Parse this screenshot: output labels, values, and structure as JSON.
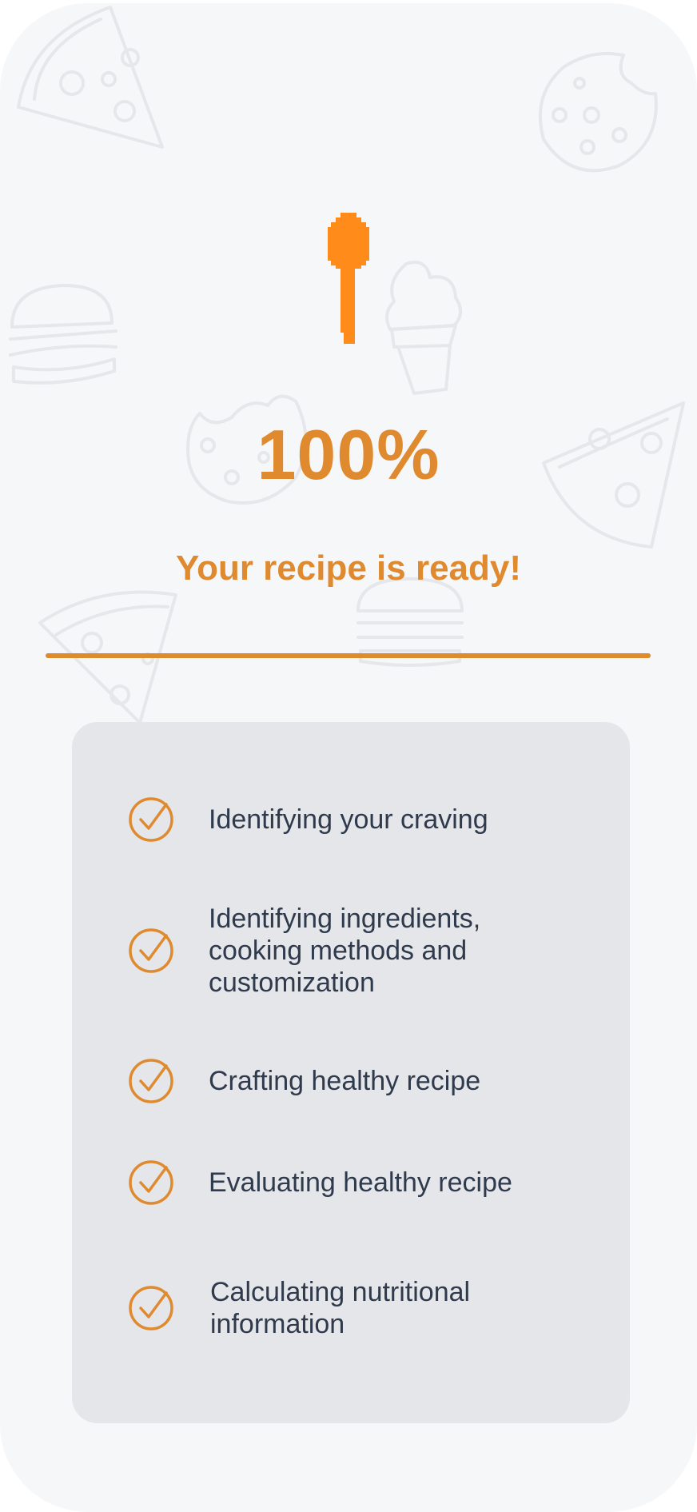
{
  "progress": {
    "percent_text": "100%",
    "value": 1.0
  },
  "status": {
    "title": "Your recipe is ready!"
  },
  "colors": {
    "accent": "#e08a2f",
    "spoon": "#ff8c1a",
    "background": "#f6f7f9",
    "card": "#e5e6e9",
    "text": "#2f3a4d"
  },
  "icons": {
    "loader": "spoon-icon",
    "step_status": "check-circle-icon",
    "background_pattern": [
      "pizza-icon",
      "cookie-icon",
      "burger-icon",
      "ice-cream-icon"
    ]
  },
  "steps": [
    {
      "label": "Identifying your craving",
      "done": true
    },
    {
      "label": "Identifying ingredients, cooking methods and customization",
      "done": true
    },
    {
      "label": "Crafting healthy recipe",
      "done": true
    },
    {
      "label": "Evaluating healthy recipe",
      "done": true
    },
    {
      "label": "Calculating nutritional information",
      "done": true
    }
  ]
}
